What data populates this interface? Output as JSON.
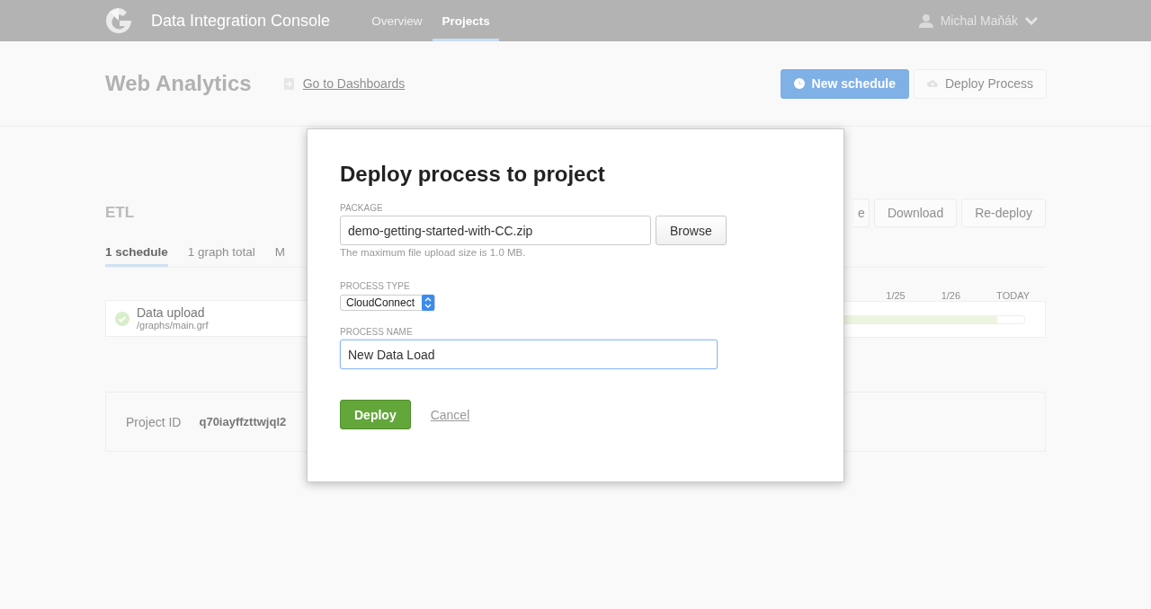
{
  "header": {
    "title": "Data Integration Console",
    "nav": [
      {
        "label": "Overview",
        "selected": false
      },
      {
        "label": "Projects",
        "selected": true
      }
    ],
    "user": "Michal Maňák"
  },
  "project": {
    "title": "Web Analytics",
    "link": "Go to Dashboards",
    "actions": [
      {
        "label": "New schedule",
        "kind": "primary"
      },
      {
        "label": "Deploy Process",
        "kind": "secondary"
      }
    ]
  },
  "process": {
    "title": "ETL",
    "buttons": [
      "e",
      "Download",
      "Re-deploy"
    ],
    "tabs": [
      {
        "label": "1 schedule",
        "selected": true
      },
      {
        "label": "1 graph total",
        "selected": false
      },
      {
        "label": "M",
        "selected": false
      }
    ],
    "dates": [
      "1/25",
      "1/26",
      "TODAY"
    ],
    "schedule": {
      "name": "Data upload",
      "path": "/graphs/main.grf",
      "level": 0.85
    }
  },
  "project_id": {
    "label": "Project ID",
    "value": "q70iayffzttwjql2"
  },
  "dialog": {
    "title": "Deploy process to project",
    "package": {
      "label": "PACKAGE",
      "value": "demo-getting-started-with-CC.zip",
      "button": "Browse",
      "hint": "The maximum file upload size is 1.0 MB."
    },
    "process_type": {
      "label": "PROCESS TYPE",
      "value": "CloudConnect"
    },
    "process_name": {
      "label": "PROCESS NAME",
      "value": "New Data Load",
      "focused": true
    },
    "deploy": "Deploy",
    "cancel": "Cancel"
  }
}
